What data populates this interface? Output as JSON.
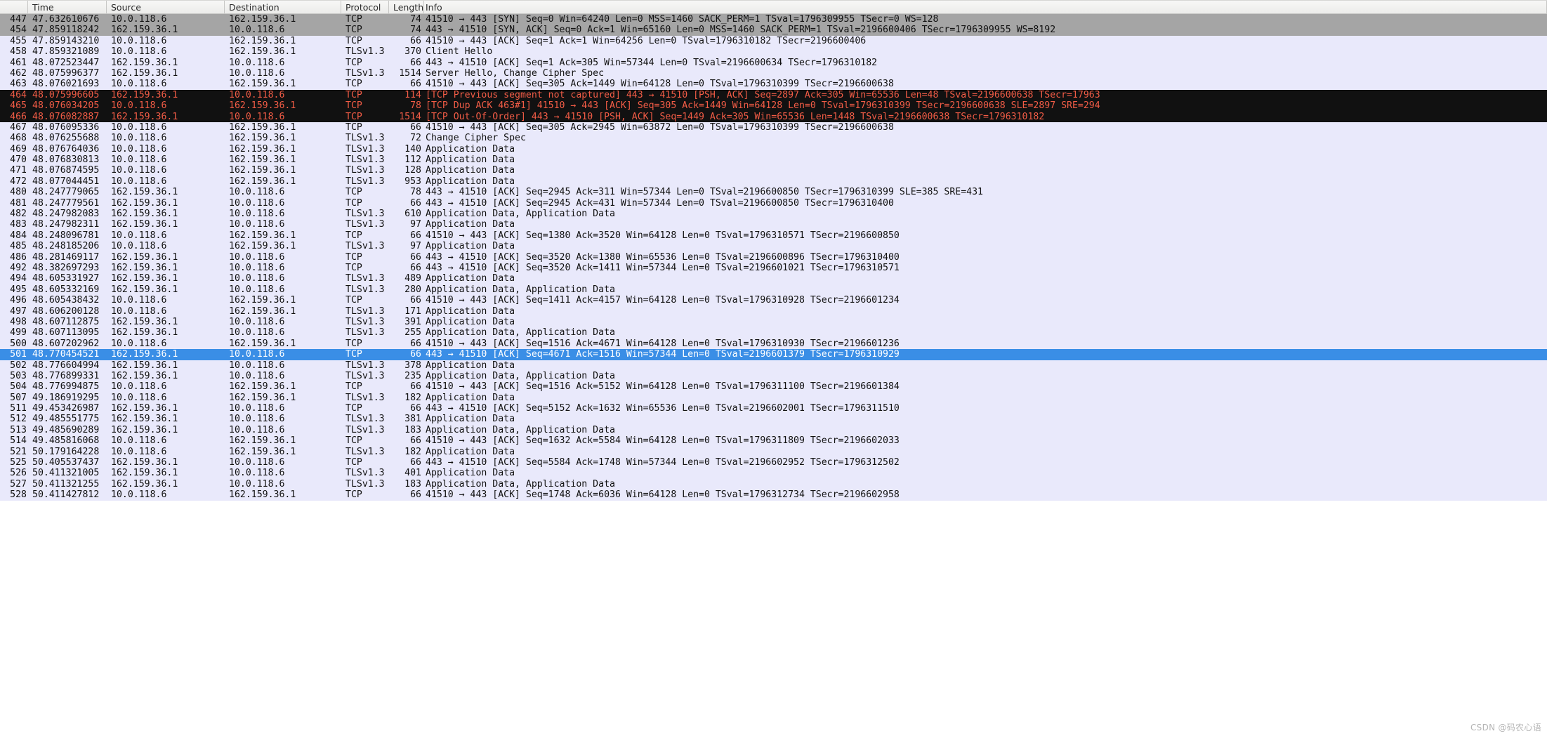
{
  "watermark": "CSDN @码农心语",
  "columns": [
    {
      "key": "no",
      "label": "",
      "class": "c-no"
    },
    {
      "key": "time",
      "label": "Time",
      "class": "c-time"
    },
    {
      "key": "src",
      "label": "Source",
      "class": "c-src"
    },
    {
      "key": "dst",
      "label": "Destination",
      "class": "c-dst"
    },
    {
      "key": "prot",
      "label": "Protocol",
      "class": "c-prot"
    },
    {
      "key": "len",
      "label": "Length",
      "class": "c-len"
    },
    {
      "key": "info",
      "label": "Info",
      "class": "c-info"
    }
  ],
  "packets": [
    {
      "no": "447",
      "time": "47.632610676",
      "src": "10.0.118.6",
      "dst": "162.159.36.1",
      "prot": "TCP",
      "len": "74",
      "info": "41510 → 443 [SYN] Seq=0 Win=64240 Len=0 MSS=1460 SACK_PERM=1 TSval=1796309955 TSecr=0 WS=128",
      "style": "st-gray"
    },
    {
      "no": "454",
      "time": "47.859118242",
      "src": "162.159.36.1",
      "dst": "10.0.118.6",
      "prot": "TCP",
      "len": "74",
      "info": "443 → 41510 [SYN, ACK] Seq=0 Ack=1 Win=65160 Len=0 MSS=1460 SACK_PERM=1 TSval=2196600406 TSecr=1796309955 WS=8192",
      "style": "st-gray"
    },
    {
      "no": "455",
      "time": "47.859143210",
      "src": "10.0.118.6",
      "dst": "162.159.36.1",
      "prot": "TCP",
      "len": "66",
      "info": "41510 → 443 [ACK] Seq=1 Ack=1 Win=64256 Len=0 TSval=1796310182 TSecr=2196600406",
      "style": "st-lavender"
    },
    {
      "no": "458",
      "time": "47.859321089",
      "src": "10.0.118.6",
      "dst": "162.159.36.1",
      "prot": "TLSv1.3",
      "len": "370",
      "info": "Client Hello",
      "style": "st-lavender"
    },
    {
      "no": "461",
      "time": "48.072523447",
      "src": "162.159.36.1",
      "dst": "10.0.118.6",
      "prot": "TCP",
      "len": "66",
      "info": "443 → 41510 [ACK] Seq=1 Ack=305 Win=57344 Len=0 TSval=2196600634 TSecr=1796310182",
      "style": "st-lavender"
    },
    {
      "no": "462",
      "time": "48.075996377",
      "src": "162.159.36.1",
      "dst": "10.0.118.6",
      "prot": "TLSv1.3",
      "len": "1514",
      "info": "Server Hello, Change Cipher Spec",
      "style": "st-lavender"
    },
    {
      "no": "463",
      "time": "48.076021693",
      "src": "10.0.118.6",
      "dst": "162.159.36.1",
      "prot": "TCP",
      "len": "66",
      "info": "41510 → 443 [ACK] Seq=305 Ack=1449 Win=64128 Len=0 TSval=1796310399 TSecr=2196600638",
      "style": "st-lavender"
    },
    {
      "no": "464",
      "time": "48.075996605",
      "src": "162.159.36.1",
      "dst": "10.0.118.6",
      "prot": "TCP",
      "len": "114",
      "info": "[TCP Previous segment not captured] 443 → 41510 [PSH, ACK] Seq=2897 Ack=305 Win=65536 Len=48 TSval=2196600638 TSecr=17963",
      "style": "st-darkred"
    },
    {
      "no": "465",
      "time": "48.076034205",
      "src": "10.0.118.6",
      "dst": "162.159.36.1",
      "prot": "TCP",
      "len": "78",
      "info": "[TCP Dup ACK 463#1] 41510 → 443 [ACK] Seq=305 Ack=1449 Win=64128 Len=0 TSval=1796310399 TSecr=2196600638 SLE=2897 SRE=294",
      "style": "st-darkred"
    },
    {
      "no": "466",
      "time": "48.076082887",
      "src": "162.159.36.1",
      "dst": "10.0.118.6",
      "prot": "TCP",
      "len": "1514",
      "info": "[TCP Out-Of-Order] 443 → 41510 [PSH, ACK] Seq=1449 Ack=305 Win=65536 Len=1448 TSval=2196600638 TSecr=1796310182",
      "style": "st-darkred"
    },
    {
      "no": "467",
      "time": "48.076095336",
      "src": "10.0.118.6",
      "dst": "162.159.36.1",
      "prot": "TCP",
      "len": "66",
      "info": "41510 → 443 [ACK] Seq=305 Ack=2945 Win=63872 Len=0 TSval=1796310399 TSecr=2196600638",
      "style": "st-lavender"
    },
    {
      "no": "468",
      "time": "48.076255688",
      "src": "10.0.118.6",
      "dst": "162.159.36.1",
      "prot": "TLSv1.3",
      "len": "72",
      "info": "Change Cipher Spec",
      "style": "st-lavender"
    },
    {
      "no": "469",
      "time": "48.076764036",
      "src": "10.0.118.6",
      "dst": "162.159.36.1",
      "prot": "TLSv1.3",
      "len": "140",
      "info": "Application Data",
      "style": "st-lavender"
    },
    {
      "no": "470",
      "time": "48.076830813",
      "src": "10.0.118.6",
      "dst": "162.159.36.1",
      "prot": "TLSv1.3",
      "len": "112",
      "info": "Application Data",
      "style": "st-lavender"
    },
    {
      "no": "471",
      "time": "48.076874595",
      "src": "10.0.118.6",
      "dst": "162.159.36.1",
      "prot": "TLSv1.3",
      "len": "128",
      "info": "Application Data",
      "style": "st-lavender"
    },
    {
      "no": "472",
      "time": "48.077044451",
      "src": "10.0.118.6",
      "dst": "162.159.36.1",
      "prot": "TLSv1.3",
      "len": "953",
      "info": "Application Data",
      "style": "st-lavender"
    },
    {
      "no": "480",
      "time": "48.247779065",
      "src": "162.159.36.1",
      "dst": "10.0.118.6",
      "prot": "TCP",
      "len": "78",
      "info": "443 → 41510 [ACK] Seq=2945 Ack=311 Win=57344 Len=0 TSval=2196600850 TSecr=1796310399 SLE=385 SRE=431",
      "style": "st-lavender"
    },
    {
      "no": "481",
      "time": "48.247779561",
      "src": "162.159.36.1",
      "dst": "10.0.118.6",
      "prot": "TCP",
      "len": "66",
      "info": "443 → 41510 [ACK] Seq=2945 Ack=431 Win=57344 Len=0 TSval=2196600850 TSecr=1796310400",
      "style": "st-lavender"
    },
    {
      "no": "482",
      "time": "48.247982083",
      "src": "162.159.36.1",
      "dst": "10.0.118.6",
      "prot": "TLSv1.3",
      "len": "610",
      "info": "Application Data, Application Data",
      "style": "st-lavender"
    },
    {
      "no": "483",
      "time": "48.247982311",
      "src": "162.159.36.1",
      "dst": "10.0.118.6",
      "prot": "TLSv1.3",
      "len": "97",
      "info": "Application Data",
      "style": "st-lavender"
    },
    {
      "no": "484",
      "time": "48.248096781",
      "src": "10.0.118.6",
      "dst": "162.159.36.1",
      "prot": "TCP",
      "len": "66",
      "info": "41510 → 443 [ACK] Seq=1380 Ack=3520 Win=64128 Len=0 TSval=1796310571 TSecr=2196600850",
      "style": "st-lavender"
    },
    {
      "no": "485",
      "time": "48.248185206",
      "src": "10.0.118.6",
      "dst": "162.159.36.1",
      "prot": "TLSv1.3",
      "len": "97",
      "info": "Application Data",
      "style": "st-lavender"
    },
    {
      "no": "486",
      "time": "48.281469117",
      "src": "162.159.36.1",
      "dst": "10.0.118.6",
      "prot": "TCP",
      "len": "66",
      "info": "443 → 41510 [ACK] Seq=3520 Ack=1380 Win=65536 Len=0 TSval=2196600896 TSecr=1796310400",
      "style": "st-lavender"
    },
    {
      "no": "492",
      "time": "48.382697293",
      "src": "162.159.36.1",
      "dst": "10.0.118.6",
      "prot": "TCP",
      "len": "66",
      "info": "443 → 41510 [ACK] Seq=3520 Ack=1411 Win=57344 Len=0 TSval=2196601021 TSecr=1796310571",
      "style": "st-lavender"
    },
    {
      "no": "494",
      "time": "48.605331927",
      "src": "162.159.36.1",
      "dst": "10.0.118.6",
      "prot": "TLSv1.3",
      "len": "489",
      "info": "Application Data",
      "style": "st-lavender"
    },
    {
      "no": "495",
      "time": "48.605332169",
      "src": "162.159.36.1",
      "dst": "10.0.118.6",
      "prot": "TLSv1.3",
      "len": "280",
      "info": "Application Data, Application Data",
      "style": "st-lavender"
    },
    {
      "no": "496",
      "time": "48.605438432",
      "src": "10.0.118.6",
      "dst": "162.159.36.1",
      "prot": "TCP",
      "len": "66",
      "info": "41510 → 443 [ACK] Seq=1411 Ack=4157 Win=64128 Len=0 TSval=1796310928 TSecr=2196601234",
      "style": "st-lavender"
    },
    {
      "no": "497",
      "time": "48.606200128",
      "src": "10.0.118.6",
      "dst": "162.159.36.1",
      "prot": "TLSv1.3",
      "len": "171",
      "info": "Application Data",
      "style": "st-lavender"
    },
    {
      "no": "498",
      "time": "48.607112875",
      "src": "162.159.36.1",
      "dst": "10.0.118.6",
      "prot": "TLSv1.3",
      "len": "391",
      "info": "Application Data",
      "style": "st-lavender"
    },
    {
      "no": "499",
      "time": "48.607113095",
      "src": "162.159.36.1",
      "dst": "10.0.118.6",
      "prot": "TLSv1.3",
      "len": "255",
      "info": "Application Data, Application Data",
      "style": "st-lavender"
    },
    {
      "no": "500",
      "time": "48.607202962",
      "src": "10.0.118.6",
      "dst": "162.159.36.1",
      "prot": "TCP",
      "len": "66",
      "info": "41510 → 443 [ACK] Seq=1516 Ack=4671 Win=64128 Len=0 TSval=1796310930 TSecr=2196601236",
      "style": "st-lavender"
    },
    {
      "no": "501",
      "time": "48.770454521",
      "src": "162.159.36.1",
      "dst": "10.0.118.6",
      "prot": "TCP",
      "len": "66",
      "info": "443 → 41510 [ACK] Seq=4671 Ack=1516 Win=57344 Len=0 TSval=2196601379 TSecr=1796310929",
      "style": "st-selected"
    },
    {
      "no": "502",
      "time": "48.776604994",
      "src": "162.159.36.1",
      "dst": "10.0.118.6",
      "prot": "TLSv1.3",
      "len": "378",
      "info": "Application Data",
      "style": "st-lavender"
    },
    {
      "no": "503",
      "time": "48.776899331",
      "src": "162.159.36.1",
      "dst": "10.0.118.6",
      "prot": "TLSv1.3",
      "len": "235",
      "info": "Application Data, Application Data",
      "style": "st-lavender"
    },
    {
      "no": "504",
      "time": "48.776994875",
      "src": "10.0.118.6",
      "dst": "162.159.36.1",
      "prot": "TCP",
      "len": "66",
      "info": "41510 → 443 [ACK] Seq=1516 Ack=5152 Win=64128 Len=0 TSval=1796311100 TSecr=2196601384",
      "style": "st-lavender"
    },
    {
      "no": "507",
      "time": "49.186919295",
      "src": "10.0.118.6",
      "dst": "162.159.36.1",
      "prot": "TLSv1.3",
      "len": "182",
      "info": "Application Data",
      "style": "st-lavender"
    },
    {
      "no": "511",
      "time": "49.453426987",
      "src": "162.159.36.1",
      "dst": "10.0.118.6",
      "prot": "TCP",
      "len": "66",
      "info": "443 → 41510 [ACK] Seq=5152 Ack=1632 Win=65536 Len=0 TSval=2196602001 TSecr=1796311510",
      "style": "st-lavender"
    },
    {
      "no": "512",
      "time": "49.485551775",
      "src": "162.159.36.1",
      "dst": "10.0.118.6",
      "prot": "TLSv1.3",
      "len": "381",
      "info": "Application Data",
      "style": "st-lavender"
    },
    {
      "no": "513",
      "time": "49.485690289",
      "src": "162.159.36.1",
      "dst": "10.0.118.6",
      "prot": "TLSv1.3",
      "len": "183",
      "info": "Application Data, Application Data",
      "style": "st-lavender"
    },
    {
      "no": "514",
      "time": "49.485816068",
      "src": "10.0.118.6",
      "dst": "162.159.36.1",
      "prot": "TCP",
      "len": "66",
      "info": "41510 → 443 [ACK] Seq=1632 Ack=5584 Win=64128 Len=0 TSval=1796311809 TSecr=2196602033",
      "style": "st-lavender"
    },
    {
      "no": "521",
      "time": "50.179164228",
      "src": "10.0.118.6",
      "dst": "162.159.36.1",
      "prot": "TLSv1.3",
      "len": "182",
      "info": "Application Data",
      "style": "st-lavender"
    },
    {
      "no": "525",
      "time": "50.405537437",
      "src": "162.159.36.1",
      "dst": "10.0.118.6",
      "prot": "TCP",
      "len": "66",
      "info": "443 → 41510 [ACK] Seq=5584 Ack=1748 Win=57344 Len=0 TSval=2196602952 TSecr=1796312502",
      "style": "st-lavender"
    },
    {
      "no": "526",
      "time": "50.411321005",
      "src": "162.159.36.1",
      "dst": "10.0.118.6",
      "prot": "TLSv1.3",
      "len": "401",
      "info": "Application Data",
      "style": "st-lavender"
    },
    {
      "no": "527",
      "time": "50.411321255",
      "src": "162.159.36.1",
      "dst": "10.0.118.6",
      "prot": "TLSv1.3",
      "len": "183",
      "info": "Application Data, Application Data",
      "style": "st-lavender"
    },
    {
      "no": "528",
      "time": "50.411427812",
      "src": "10.0.118.6",
      "dst": "162.159.36.1",
      "prot": "TCP",
      "len": "66",
      "info": "41510 → 443 [ACK] Seq=1748 Ack=6036 Win=64128 Len=0 TSval=1796312734 TSecr=2196602958",
      "style": "st-lavender"
    }
  ]
}
